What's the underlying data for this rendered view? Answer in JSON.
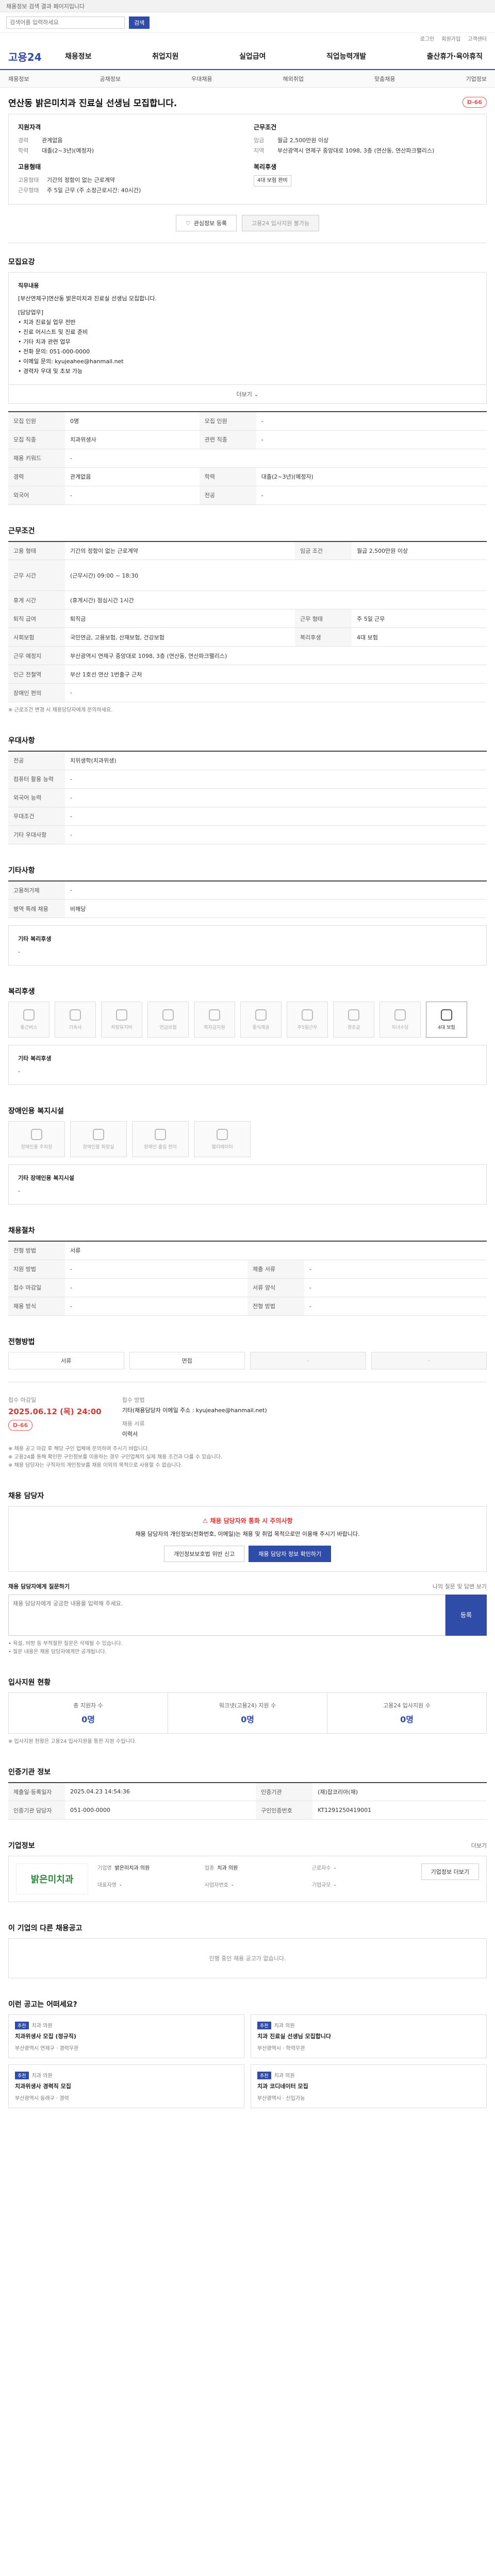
{
  "topbar": {
    "notice": "채용정보 검색 결과 페이지입니다"
  },
  "search": {
    "placeholder": "검색어를 입력하세요",
    "button": "검색"
  },
  "util": {
    "links": [
      "로그인",
      "회원가입",
      "고객센터"
    ]
  },
  "gnb": {
    "logo": "고용24",
    "menu": [
      "채용정보",
      "취업지원",
      "실업급여",
      "직업능력개발",
      "출산휴가·육아휴직"
    ]
  },
  "subnav": {
    "items": [
      "채용정보",
      "공채정보",
      "우대채용",
      "해외취업",
      "맞춤채용",
      "기업정보"
    ]
  },
  "job": {
    "title": "연산동 밝은미치과 진료실 선생님 모집합니다.",
    "dday": "D-66",
    "company_head": "지원자격",
    "work_head": "근무조건",
    "summary_left": [
      {
        "k": "경력",
        "v": "관계없음"
      },
      {
        "k": "학력",
        "v": "대졸(2~3년)(예정자)"
      }
    ],
    "summary_right": [
      {
        "k": "임금",
        "v": "월급 2,500만원 이상"
      },
      {
        "k": "지역",
        "v": "부산광역시 연제구 중앙대로 1098, 3층 (연산동, 연산파크팰리스)"
      }
    ],
    "summary_left2_head": "고용형태",
    "summary_left2": [
      {
        "k": "고용형태",
        "v": "기간의 정함이 없는 근로계약"
      },
      {
        "k": "근무형태",
        "v": "주 5일 근무 (주 소정근로시간: 40시간)"
      }
    ],
    "summary_right2_head": "복리후생",
    "summary_right2": [
      {
        "k": "",
        "v": "4대 보험 완비"
      }
    ],
    "btn_scrap": "관심정보 등록",
    "btn_apply": "고용24 입사지원 불가능"
  },
  "recruit": {
    "heading": "모집요강",
    "box_title": "직무내용",
    "box_lines": [
      "[부산연제구]연산동 밝은미치과 진료실 선생님 모집합니다.",
      "",
      "[담당업무]",
      "• 치과 진료실 업무 전반",
      "• 진료 어시스트 및 진료 준비",
      "• 기타 치과 관련 업무",
      "• 전화 문의: 051-000-0000",
      "• 이메일 문의: kyujeahee@hanmail.net",
      "• 경력자 우대 및 초보 가능"
    ],
    "more": "더보기",
    "rows": [
      {
        "k": "모집 인원",
        "v": "0명",
        "k2": "모집 인원",
        "v2": "-"
      },
      {
        "k": "모집 직종",
        "v": "치과위생사",
        "k2": "관련 직종",
        "v2": "-"
      },
      {
        "k": "채용 키워드",
        "v": "-",
        "k2": "",
        "v2": ""
      },
      {
        "k": "경력",
        "v": "관계없음",
        "k2": "학력",
        "v2": "대졸(2~3년)(예정자)"
      },
      {
        "k": "외국어",
        "v": "-",
        "k2": "전공",
        "v2": "-"
      }
    ]
  },
  "conditions": {
    "heading": "근무조건",
    "rows": [
      {
        "k": "고용 형태",
        "v": "기간의 정함이 없는 근로계약",
        "k2": "임금 조건",
        "v2": "월급 2,500만원 이상"
      },
      {
        "k": "근무 시간",
        "v": "(근무시간) 09:00 ~ 18:30",
        "k2": "",
        "v2": ""
      },
      {
        "k": "휴게 시간",
        "v": "(휴게시간) 점심시간 1시간",
        "k2": "",
        "v2": ""
      },
      {
        "k": "퇴직 급여",
        "v": "퇴직금",
        "k2": "근무 형태",
        "v2": "주 5일 근무"
      },
      {
        "k": "사회보험",
        "v": "국민연금, 고용보험, 산재보험, 건강보험",
        "k2": "복리후생",
        "v2": "4대 보험"
      },
      {
        "k": "근무 예정지",
        "v": "부산광역시 연제구 중앙대로 1098, 3층 (연산동, 연산파크팰리스)",
        "k2": "",
        "v2": ""
      },
      {
        "k": "인근 전철역",
        "v": "부산 1호선 연산 1번출구 근처",
        "k2": "",
        "v2": ""
      },
      {
        "k": "장애인 편의",
        "v": "-",
        "k2": "",
        "v2": ""
      }
    ],
    "note": "※ 근로조건 변경 시 채용담당자에게 문의하세요."
  },
  "preference": {
    "heading": "우대사항",
    "rows": [
      {
        "k": "전공",
        "v": "치위생학(치과위생)"
      },
      {
        "k": "컴퓨터 활용 능력",
        "v": "-"
      },
      {
        "k": "외국어 능력",
        "v": "-"
      },
      {
        "k": "우대조건",
        "v": "-"
      },
      {
        "k": "기타 우대사항",
        "v": "-"
      }
    ]
  },
  "other": {
    "heading": "기타사항",
    "rows": [
      {
        "k": "고용허가제",
        "v": "-"
      },
      {
        "k": "병역 특례 채용",
        "v": "비해당"
      }
    ],
    "etc_label": "기타 복리후생",
    "etc_value": "-"
  },
  "welfare": {
    "heading": "복리후생",
    "cards": [
      {
        "label": "통근버스",
        "on": false
      },
      {
        "label": "기숙사",
        "on": false
      },
      {
        "label": "차량유지비",
        "on": false
      },
      {
        "label": "연금보험",
        "on": false
      },
      {
        "label": "학자금지원",
        "on": false
      },
      {
        "label": "중식제공",
        "on": false
      },
      {
        "label": "주5일근무",
        "on": false
      },
      {
        "label": "경조금",
        "on": false
      },
      {
        "label": "자녀수당",
        "on": false
      },
      {
        "label": "4대 보험",
        "on": true
      }
    ],
    "etc_label": "기타 복리후생",
    "etc_value": "-"
  },
  "disability": {
    "heading": "장애인용 복지시설",
    "cards": [
      {
        "label": "장애인용 주차장",
        "on": false
      },
      {
        "label": "장애인용 화장실",
        "on": false
      },
      {
        "label": "장애인 출입 편의",
        "on": false
      },
      {
        "label": "엘리베이터",
        "on": false
      }
    ],
    "etc_label": "기타 장애인용 복지시설",
    "etc_value": "-"
  },
  "recruit_proc": {
    "heading": "채용절차",
    "rows": [
      {
        "k": "전형 방법",
        "v": "서류",
        "k2": "",
        "v2": ""
      },
      {
        "k": "지원 방법",
        "v": "-",
        "k2": "제출 서류",
        "v2": "-"
      },
      {
        "k": "접수 마감일",
        "v": "-",
        "k2": "서류 양식",
        "v2": "-"
      },
      {
        "k": "채용 방식",
        "v": "-",
        "k2": "전형 방법",
        "v2": "-"
      }
    ]
  },
  "process": {
    "heading": "전형방법",
    "steps": [
      "서류",
      "면접",
      "-",
      "-"
    ]
  },
  "apply": {
    "deadline_label": "접수 마감일",
    "deadline": "2025.06.12 (목) 24:00",
    "dday": "D-66",
    "method_label": "접수 방법",
    "method": "기타(채용담당자 이메일 주소 : kyujeahee@hanmail.net)",
    "contact_label": "채용 서류",
    "contact": "이력서",
    "notes": [
      "※ 채용 공고 마감 후 해당 구인 업체에 문의하여 주시기 바랍니다.",
      "※ 고용24를 통해 확인한 구인정보를 이용하는 경우 구인업체의 실제 채용 조건과 다를 수 있습니다.",
      "※ 채용 담당자는 구직자의 개인정보를 채용 이외의 목적으로 사용할 수 없습니다."
    ]
  },
  "contact": {
    "heading": "채용 담당자",
    "warn_title": "채용 담당자와 통화 시 주의사항",
    "warn_text": "채용 담당자의 개인정보(전화번호, 이메일)는 채용 및 취업 목적으로만 이용해 주시기 바랍니다.",
    "btn1": "개인정보보호법 위반 신고",
    "btn2": "채용 담당자 정보 확인하기",
    "qa_label": "채용 담당자에게 질문하기",
    "qa_link": "나의 질문 및 답변 보기",
    "qa_placeholder": "채용 담당자에게 궁금한 내용을 입력해 주세요.",
    "qa_send": "등록",
    "qa_notes": [
      "• 욕설, 비방 등 부적절한 질문은 삭제될 수 있습니다.",
      "• 질문 내용은 채용 담당자에게만 공개됩니다."
    ]
  },
  "stats": {
    "heading": "입사지원 현황",
    "items": [
      {
        "label": "총 지원자 수",
        "value": "0명"
      },
      {
        "label": "워크넷(고용24) 지원 수",
        "value": "0명"
      },
      {
        "label": "고용24 입사지원 수",
        "value": "0명"
      }
    ],
    "note": "※ 입사지원 현황은 고용24 입사지원을 통한 지원 수입니다."
  },
  "agency": {
    "heading": "인증기관 정보",
    "rows": [
      {
        "k": "제출일·등록일자",
        "v": "2025.04.23 14:54:36",
        "k2": "인증기관",
        "v2": "(재)잡코리아(재)"
      },
      {
        "k": "인증기관 담당자",
        "v": "051-000-0000",
        "k2": "구인인증번호",
        "v2": "KT1291250419001"
      }
    ]
  },
  "company": {
    "heading": "기업정보",
    "more": "더보기",
    "logo": "밝은미치과",
    "info": [
      {
        "k": "기업명",
        "v": "밝은미치과 의원"
      },
      {
        "k": "업종",
        "v": "치과 의원"
      },
      {
        "k": "근로자수",
        "v": "-"
      },
      {
        "k": "대표자명",
        "v": "-"
      },
      {
        "k": "사업자번호",
        "v": "-"
      },
      {
        "k": "기업규모",
        "v": "-"
      }
    ],
    "btn_more": "기업정보 더보기"
  },
  "others": {
    "heading": "이 기업의 다른 채용공고",
    "empty": "진행 중인 채용 공고가 없습니다."
  },
  "recommend": {
    "heading": "이런 공고는 어떠세요?",
    "items": [
      {
        "tag": "추천",
        "company": "치과 의원",
        "title": "치과위생사 모집 (정규직)",
        "cond": "부산광역시 연제구 · 경력무관"
      },
      {
        "tag": "추천",
        "company": "치과 의원",
        "title": "치과 진료실 선생님 모집합니다",
        "cond": "부산광역시 · 학력무관"
      },
      {
        "tag": "추천",
        "company": "치과 의원",
        "title": "치과위생사 경력직 모집",
        "cond": "부산광역시 동래구 · 경력"
      },
      {
        "tag": "추천",
        "company": "치과 의원",
        "title": "치과 코디네이터 모집",
        "cond": "부산광역시 · 신입가능"
      }
    ]
  }
}
